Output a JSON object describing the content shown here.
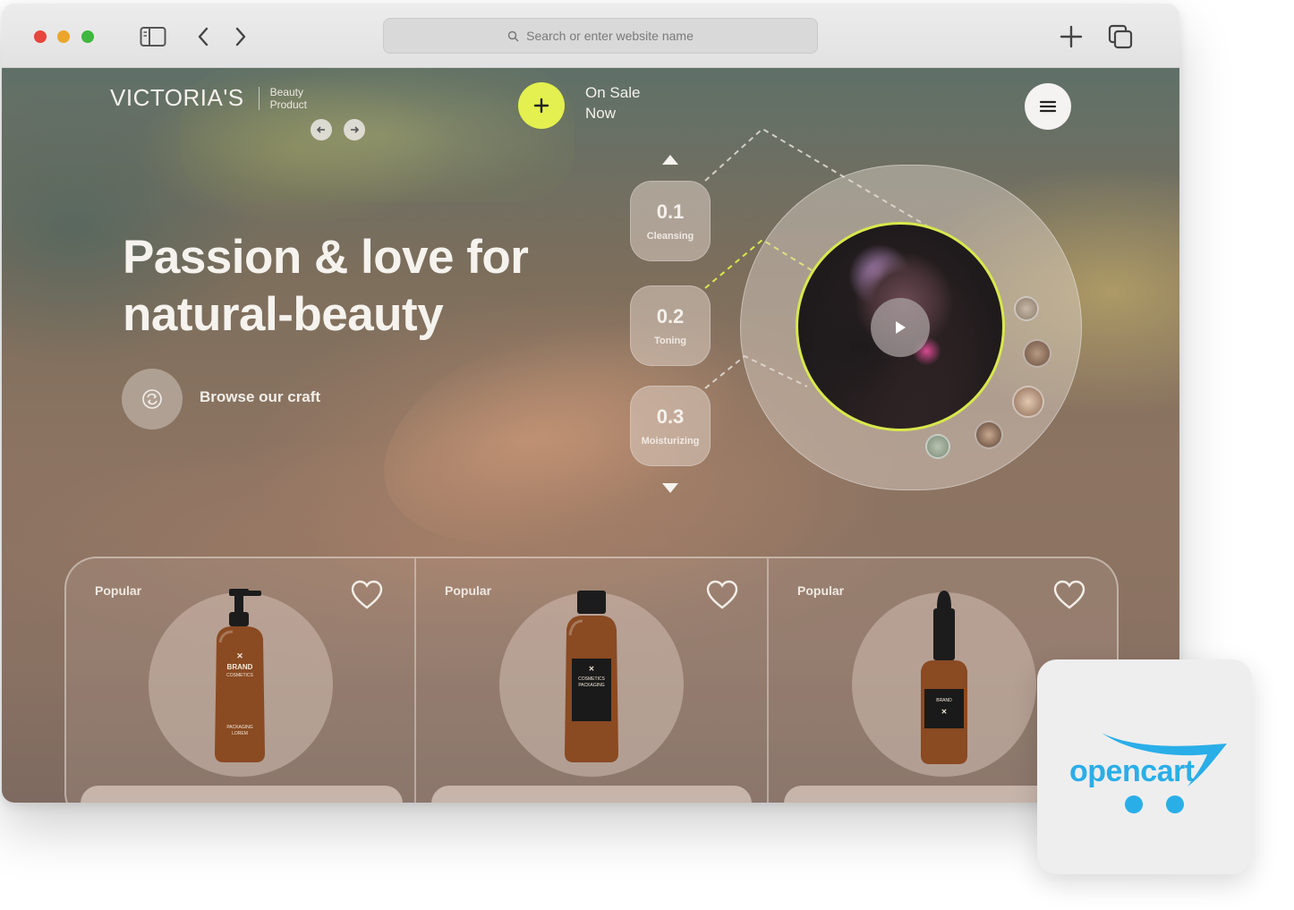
{
  "browser": {
    "address_placeholder": "Search or enter website name"
  },
  "site": {
    "brand_name": "VICTORIA'S",
    "brand_sub_line1": "Beauty",
    "brand_sub_line2": "Product",
    "sale_line1": "On Sale",
    "sale_line2": "Now",
    "hero_line1": "Passion & love for",
    "hero_line2": "natural-beauty",
    "browse_label": "Browse our craft",
    "steps": [
      {
        "num": "0.1",
        "label": "Cleansing"
      },
      {
        "num": "0.2",
        "label": "Toning"
      },
      {
        "num": "0.3",
        "label": "Moisturizing"
      }
    ],
    "products": [
      {
        "tag": "Popular",
        "label_line1": "BRAND",
        "label_line2": "COSMETICS",
        "label_line3": "PACKAGING",
        "label_line4": "LOREM"
      },
      {
        "tag": "Popular",
        "label_line1": "COSMETICS",
        "label_line2": "PACKAGING"
      },
      {
        "tag": "Popular",
        "label_line1": "BRAND"
      }
    ]
  },
  "badge": {
    "text": "opencart"
  },
  "colors": {
    "accent_lime": "#e3f04f",
    "opencart_blue": "#2aaee8",
    "amber_bottle": "#8a4a22"
  }
}
